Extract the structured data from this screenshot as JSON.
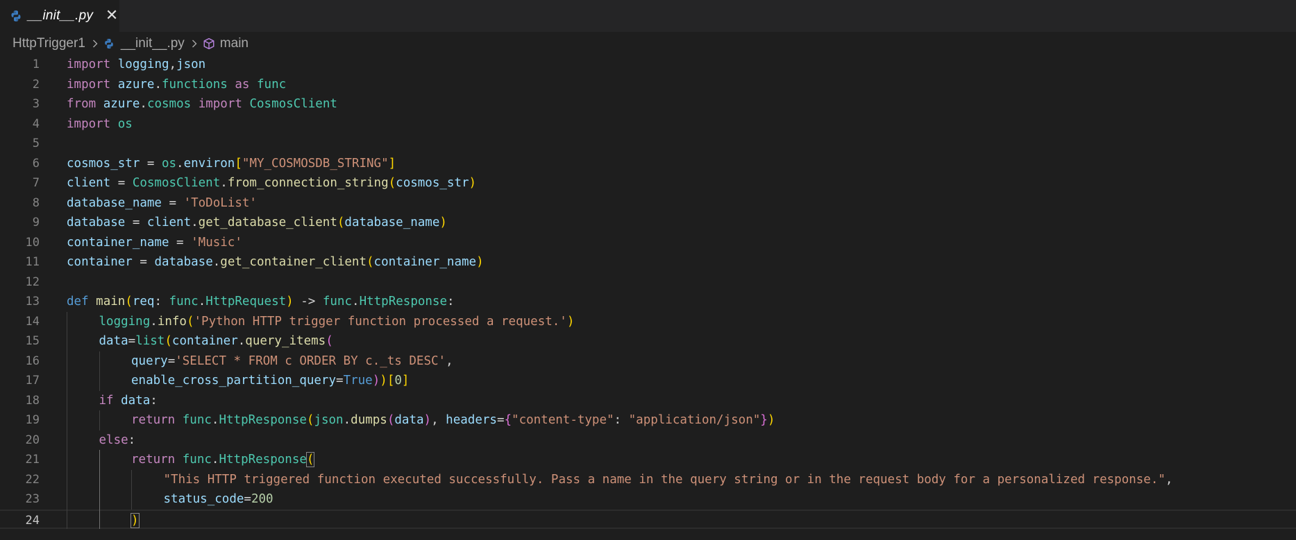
{
  "tab": {
    "label": "__init__.py",
    "icon": "python-icon",
    "close_glyph": "✕"
  },
  "breadcrumb": {
    "folder": "HttpTrigger1",
    "file": "__init__.py",
    "symbol": "main",
    "symbol_icon": "cube-icon"
  },
  "editor": {
    "current_line": 24,
    "lines": [
      {
        "n": "1",
        "indent": 0,
        "tokens": [
          [
            "k",
            "import"
          ],
          [
            "p",
            " "
          ],
          [
            "v",
            "logging"
          ],
          [
            "p",
            ","
          ],
          [
            "v",
            "json"
          ]
        ]
      },
      {
        "n": "2",
        "indent": 0,
        "tokens": [
          [
            "k",
            "import"
          ],
          [
            "p",
            " "
          ],
          [
            "v",
            "azure"
          ],
          [
            "p",
            "."
          ],
          [
            "t",
            "functions"
          ],
          [
            "p",
            " "
          ],
          [
            "k",
            "as"
          ],
          [
            "p",
            " "
          ],
          [
            "t",
            "func"
          ]
        ]
      },
      {
        "n": "3",
        "indent": 0,
        "tokens": [
          [
            "k",
            "from"
          ],
          [
            "p",
            " "
          ],
          [
            "v",
            "azure"
          ],
          [
            "p",
            "."
          ],
          [
            "t",
            "cosmos"
          ],
          [
            "p",
            " "
          ],
          [
            "k",
            "import"
          ],
          [
            "p",
            " "
          ],
          [
            "t",
            "CosmosClient"
          ]
        ]
      },
      {
        "n": "4",
        "indent": 0,
        "tokens": [
          [
            "k",
            "import"
          ],
          [
            "p",
            " "
          ],
          [
            "t",
            "os"
          ]
        ]
      },
      {
        "n": "5",
        "indent": 0,
        "tokens": []
      },
      {
        "n": "6",
        "indent": 0,
        "tokens": [
          [
            "v",
            "cosmos_str"
          ],
          [
            "p",
            " = "
          ],
          [
            "t",
            "os"
          ],
          [
            "p",
            "."
          ],
          [
            "v",
            "environ"
          ],
          [
            "b1",
            "["
          ],
          [
            "s",
            "\"MY_COSMOSDB_STRING\""
          ],
          [
            "b1",
            "]"
          ]
        ]
      },
      {
        "n": "7",
        "indent": 0,
        "tokens": [
          [
            "v",
            "client"
          ],
          [
            "p",
            " = "
          ],
          [
            "t",
            "CosmosClient"
          ],
          [
            "p",
            "."
          ],
          [
            "f",
            "from_connection_string"
          ],
          [
            "b1",
            "("
          ],
          [
            "v",
            "cosmos_str"
          ],
          [
            "b1",
            ")"
          ]
        ]
      },
      {
        "n": "8",
        "indent": 0,
        "tokens": [
          [
            "v",
            "database_name"
          ],
          [
            "p",
            " = "
          ],
          [
            "s",
            "'ToDoList'"
          ]
        ]
      },
      {
        "n": "9",
        "indent": 0,
        "tokens": [
          [
            "v",
            "database"
          ],
          [
            "p",
            " = "
          ],
          [
            "v",
            "client"
          ],
          [
            "p",
            "."
          ],
          [
            "f",
            "get_database_client"
          ],
          [
            "b1",
            "("
          ],
          [
            "v",
            "database_name"
          ],
          [
            "b1",
            ")"
          ]
        ]
      },
      {
        "n": "10",
        "indent": 0,
        "tokens": [
          [
            "v",
            "container_name"
          ],
          [
            "p",
            " = "
          ],
          [
            "s",
            "'Music'"
          ]
        ]
      },
      {
        "n": "11",
        "indent": 0,
        "tokens": [
          [
            "v",
            "container"
          ],
          [
            "p",
            " = "
          ],
          [
            "v",
            "database"
          ],
          [
            "p",
            "."
          ],
          [
            "f",
            "get_container_client"
          ],
          [
            "b1",
            "("
          ],
          [
            "v",
            "container_name"
          ],
          [
            "b1",
            ")"
          ]
        ]
      },
      {
        "n": "12",
        "indent": 0,
        "tokens": []
      },
      {
        "n": "13",
        "indent": 0,
        "tokens": [
          [
            "d",
            "def"
          ],
          [
            "p",
            " "
          ],
          [
            "f",
            "main"
          ],
          [
            "b1",
            "("
          ],
          [
            "v",
            "req"
          ],
          [
            "p",
            ": "
          ],
          [
            "t",
            "func"
          ],
          [
            "p",
            "."
          ],
          [
            "t",
            "HttpRequest"
          ],
          [
            "b1",
            ")"
          ],
          [
            "p",
            " -> "
          ],
          [
            "t",
            "func"
          ],
          [
            "p",
            "."
          ],
          [
            "t",
            "HttpResponse"
          ],
          [
            "p",
            ":"
          ]
        ]
      },
      {
        "n": "14",
        "indent": 1,
        "tokens": [
          [
            "t",
            "logging"
          ],
          [
            "p",
            "."
          ],
          [
            "f",
            "info"
          ],
          [
            "b1",
            "("
          ],
          [
            "s",
            "'Python HTTP trigger function processed a request.'"
          ],
          [
            "b1",
            ")"
          ]
        ]
      },
      {
        "n": "15",
        "indent": 1,
        "tokens": [
          [
            "v",
            "data"
          ],
          [
            "p",
            "="
          ],
          [
            "t",
            "list"
          ],
          [
            "b1",
            "("
          ],
          [
            "v",
            "container"
          ],
          [
            "p",
            "."
          ],
          [
            "f",
            "query_items"
          ],
          [
            "b2",
            "("
          ]
        ]
      },
      {
        "n": "16",
        "indent": 2,
        "tokens": [
          [
            "v",
            "query"
          ],
          [
            "p",
            "="
          ],
          [
            "s",
            "'SELECT * FROM c ORDER BY c._ts DESC'"
          ],
          [
            "p",
            ","
          ]
        ]
      },
      {
        "n": "17",
        "indent": 2,
        "tokens": [
          [
            "v",
            "enable_cross_partition_query"
          ],
          [
            "p",
            "="
          ],
          [
            "d",
            "True"
          ],
          [
            "b2",
            ")"
          ],
          [
            "b1",
            ")"
          ],
          [
            "b1",
            "["
          ],
          [
            "n",
            "0"
          ],
          [
            "b1",
            "]"
          ]
        ]
      },
      {
        "n": "18",
        "indent": 1,
        "tokens": [
          [
            "k",
            "if"
          ],
          [
            "p",
            " "
          ],
          [
            "v",
            "data"
          ],
          [
            "p",
            ":"
          ]
        ]
      },
      {
        "n": "19",
        "indent": 2,
        "tokens": [
          [
            "k",
            "return"
          ],
          [
            "p",
            " "
          ],
          [
            "t",
            "func"
          ],
          [
            "p",
            "."
          ],
          [
            "t",
            "HttpResponse"
          ],
          [
            "b1",
            "("
          ],
          [
            "t",
            "json"
          ],
          [
            "p",
            "."
          ],
          [
            "f",
            "dumps"
          ],
          [
            "b2",
            "("
          ],
          [
            "v",
            "data"
          ],
          [
            "b2",
            ")"
          ],
          [
            "p",
            ", "
          ],
          [
            "v",
            "headers"
          ],
          [
            "p",
            "="
          ],
          [
            "b2",
            "{"
          ],
          [
            "s",
            "\"content-type\""
          ],
          [
            "p",
            ": "
          ],
          [
            "s",
            "\"application/json\""
          ],
          [
            "b2",
            "}"
          ],
          [
            "b1",
            ")"
          ]
        ]
      },
      {
        "n": "20",
        "indent": 1,
        "tokens": [
          [
            "k",
            "else"
          ],
          [
            "p",
            ":"
          ]
        ]
      },
      {
        "n": "21",
        "indent": 2,
        "tokens": [
          [
            "k",
            "return"
          ],
          [
            "p",
            " "
          ],
          [
            "t",
            "func"
          ],
          [
            "p",
            "."
          ],
          [
            "t",
            "HttpResponse"
          ],
          [
            "b1c",
            "("
          ]
        ]
      },
      {
        "n": "22",
        "indent": 3,
        "tokens": [
          [
            "s",
            "\"This HTTP triggered function executed successfully. Pass a name in the query string or in the request body for a personalized response.\""
          ],
          [
            "p",
            ","
          ]
        ]
      },
      {
        "n": "23",
        "indent": 3,
        "tokens": [
          [
            "v",
            "status_code"
          ],
          [
            "p",
            "="
          ],
          [
            "n",
            "200"
          ]
        ]
      },
      {
        "n": "24",
        "indent": 2,
        "tokens": [
          [
            "b1c",
            ")"
          ]
        ]
      }
    ]
  }
}
